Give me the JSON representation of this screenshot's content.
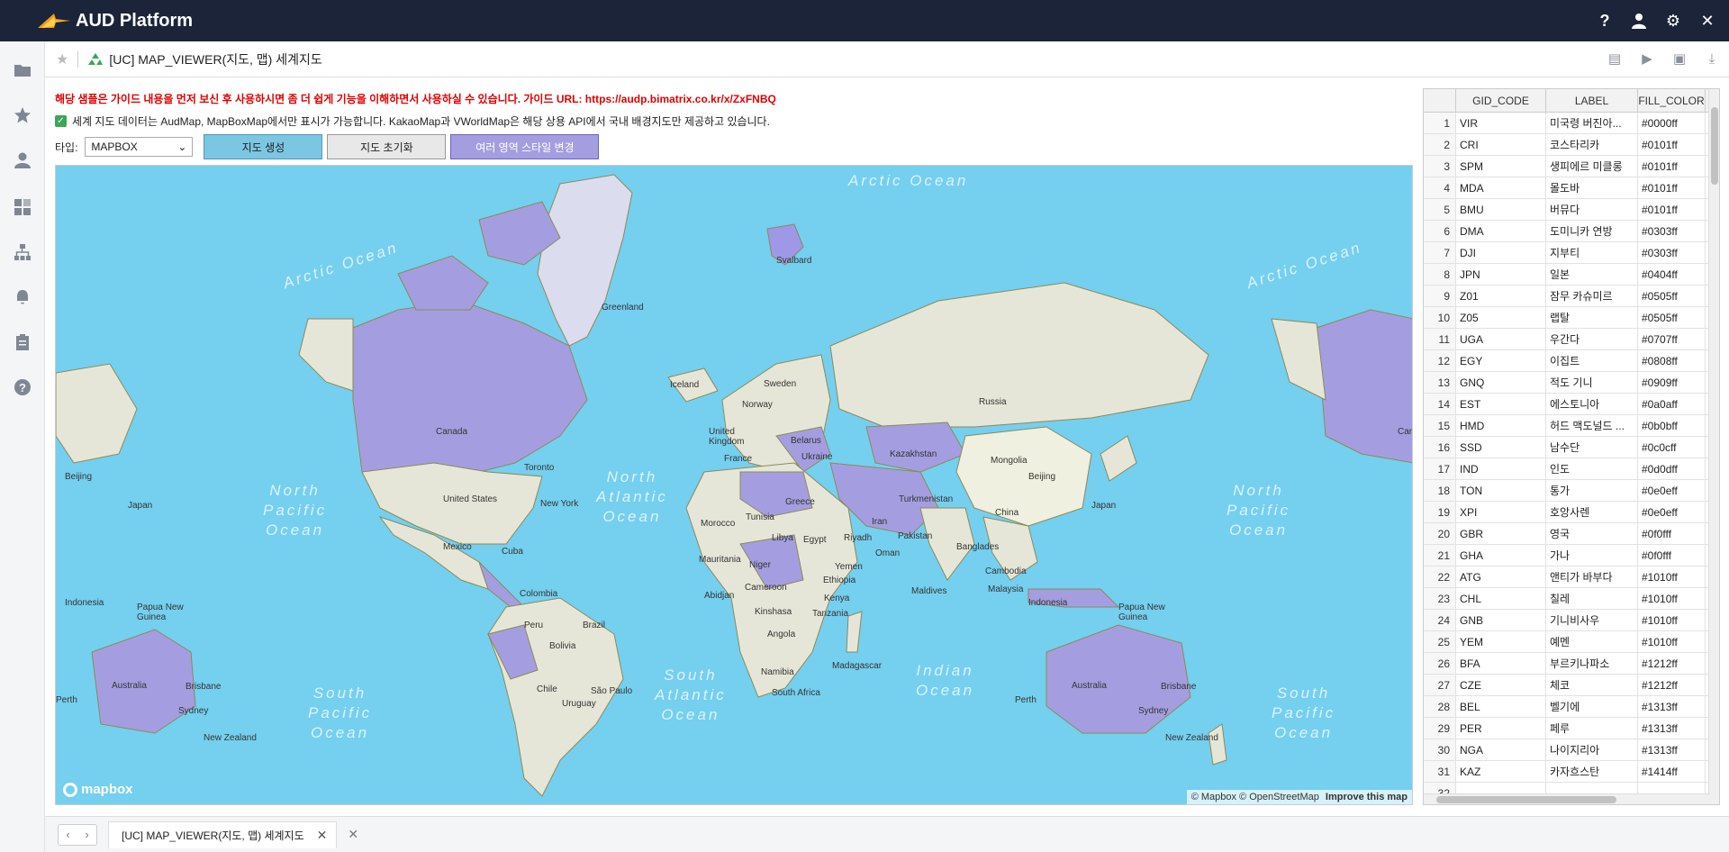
{
  "app": {
    "title": "AUD Platform"
  },
  "topbar": {
    "icons": [
      "help-icon",
      "user-icon",
      "gear-icon",
      "close-icon"
    ]
  },
  "leftnav": {
    "items": [
      "folder-icon",
      "star-icon",
      "person-icon",
      "dashboard-icon",
      "sitemap-icon",
      "alarm-icon",
      "clipboard-icon",
      "question-icon"
    ]
  },
  "page": {
    "title": "[UC] MAP_VIEWER(지도, 맵) 세계지도",
    "notice": "해당 샘플은 가이드 내용을 먼저 보신 후 사용하시면 좀 더 쉽게 기능을 이해하면서 사용하실 수 있습니다. 가이드 URL: https://audp.bimatrix.co.kr/x/ZxFNBQ",
    "check_text": "세계 지도 데이터는 AudMap, MapBoxMap에서만 표시가 가능합니다. KakaoMap과 VWorldMap은 해당 상용 API에서 국내 배경지도만 제공하고 있습니다.",
    "type_label": "타입:",
    "type_value": "MAPBOX",
    "btn_create": "지도 생성",
    "btn_reset": "지도 초기화",
    "btn_style": "여러 영역 스타일 변경"
  },
  "map": {
    "ocean_labels": {
      "arctic_top": "Arctic Ocean",
      "arctic_left": "Arctic Ocean",
      "arctic_right": "Arctic Ocean",
      "npac_left": "North\nPacific\nOcean",
      "natl": "North\nAtlantic\nOcean",
      "npac_right": "North\nPacific\nOcean",
      "spac_left": "South\nPacific\nOcean",
      "satl": "South\nAtlantic\nOcean",
      "indian": "Indian\nOcean",
      "spac_right": "South\nPacific\nOcean"
    },
    "land_labels": {
      "greenland": "Greenland",
      "svalbard": "Svalbard",
      "iceland": "Iceland",
      "sweden": "Sweden",
      "norway": "Norway",
      "russia": "Russia",
      "canada": "Canada",
      "canada2": "Can",
      "united_kingdom": "United\nKingdom",
      "belarus": "Belarus",
      "ukraine": "Ukraine",
      "france": "France",
      "kazakhstan": "Kazakhstan",
      "mongolia": "Mongolia",
      "beijing": "Beijing",
      "beijing_left": "Beijing",
      "toronto": "Toronto",
      "united_states": "United States",
      "new_york": "New York",
      "japan": "Japan",
      "japan_left": "Japan",
      "turkmenistan": "Turkmenistan",
      "greece": "Greece",
      "tunisia": "Tunisia",
      "iran": "Iran",
      "china": "China",
      "morocco": "Morocco",
      "pakistan": "Pakistan",
      "libya": "Libya",
      "egypt": "Egypt",
      "riyadh": "Riyadh",
      "mexico": "Mexico",
      "cuba": "Cuba",
      "bangladesh": "Banglades",
      "oman": "Oman",
      "mauritania": "Mauritania",
      "niger": "Niger",
      "yemen": "Yemen",
      "cambodia": "Cambodia",
      "ethiopia": "Ethiopia",
      "cameroon": "Cameroon",
      "abidjan": "Abidjan",
      "colombia": "Colombia",
      "maldives": "Maldives",
      "malaysia": "Malaysia",
      "indonesia": "Indonesia",
      "indonesia_left": "Indonesia",
      "kenya": "Kenya",
      "tanzania": "Tanzania",
      "kinshasa": "Kinshasa",
      "papua_new_guinea": "Papua New\nGuinea",
      "papua_new_guinea_left": "Papua New\nGuinea",
      "peru": "Peru",
      "brazil": "Brazil",
      "angola": "Angola",
      "bolivia": "Bolivia",
      "namibia": "Namibia",
      "madagascar": "Madagascar",
      "australia": "Australia",
      "australia_left": "Australia",
      "brisbane": "Brisbane",
      "brisbane_left": "Brisbane",
      "sao_paulo": "São Paulo",
      "chile": "Chile",
      "south_africa": "South Africa",
      "uruguay": "Uruguay",
      "perth": "Perth",
      "perth_left": "Perth",
      "sydney": "Sydney",
      "sydney_left": "Sydney",
      "new_zealand": "New Zealand",
      "new_zealand_left": "New Zealand"
    },
    "logo_text": "mapbox",
    "attribution": "© Mapbox © OpenStreetMap",
    "improve": "Improve this map"
  },
  "grid": {
    "headers": [
      "",
      "GID_CODE",
      "LABEL",
      "FILL_COLOR"
    ],
    "rows": [
      [
        "1",
        "VIR",
        "미국령 버진아...",
        "#0000ff"
      ],
      [
        "2",
        "CRI",
        "코스타리카",
        "#0101ff"
      ],
      [
        "3",
        "SPM",
        "생피에르 미클롱",
        "#0101ff"
      ],
      [
        "4",
        "MDA",
        "몰도바",
        "#0101ff"
      ],
      [
        "5",
        "BMU",
        "버뮤다",
        "#0101ff"
      ],
      [
        "6",
        "DMA",
        "도미니카 연방",
        "#0303ff"
      ],
      [
        "7",
        "DJI",
        "지부티",
        "#0303ff"
      ],
      [
        "8",
        "JPN",
        "일본",
        "#0404ff"
      ],
      [
        "9",
        "Z01",
        "잠무 카슈미르",
        "#0505ff"
      ],
      [
        "10",
        "Z05",
        "랩탈",
        "#0505ff"
      ],
      [
        "11",
        "UGA",
        "우간다",
        "#0707ff"
      ],
      [
        "12",
        "EGY",
        "이집트",
        "#0808ff"
      ],
      [
        "13",
        "GNQ",
        "적도 기니",
        "#0909ff"
      ],
      [
        "14",
        "EST",
        "에스토니아",
        "#0a0aff"
      ],
      [
        "15",
        "HMD",
        "허드 맥도널드 ...",
        "#0b0bff"
      ],
      [
        "16",
        "SSD",
        "남수단",
        "#0c0cff"
      ],
      [
        "17",
        "IND",
        "인도",
        "#0d0dff"
      ],
      [
        "18",
        "TON",
        "통가",
        "#0e0eff"
      ],
      [
        "19",
        "XPI",
        "호앙사렌",
        "#0e0eff"
      ],
      [
        "20",
        "GBR",
        "영국",
        "#0f0fff"
      ],
      [
        "21",
        "GHA",
        "가나",
        "#0f0fff"
      ],
      [
        "22",
        "ATG",
        "앤티가 바부다",
        "#1010ff"
      ],
      [
        "23",
        "CHL",
        "칠레",
        "#1010ff"
      ],
      [
        "24",
        "GNB",
        "기니비사우",
        "#1010ff"
      ],
      [
        "25",
        "YEM",
        "예멘",
        "#1010ff"
      ],
      [
        "26",
        "BFA",
        "부르키나파소",
        "#1212ff"
      ],
      [
        "27",
        "CZE",
        "체코",
        "#1212ff"
      ],
      [
        "28",
        "BEL",
        "벨기에",
        "#1313ff"
      ],
      [
        "29",
        "PER",
        "페루",
        "#1313ff"
      ],
      [
        "30",
        "NGA",
        "나이지리아",
        "#1313ff"
      ],
      [
        "31",
        "KAZ",
        "카자흐스탄",
        "#1414ff"
      ],
      [
        "32",
        "",
        "",
        ""
      ]
    ]
  },
  "bottom": {
    "tab_label": "[UC] MAP_VIEWER(지도, 맵) 세계지도",
    "tab_close": "✕",
    "close_all": "✕"
  },
  "colors": {
    "topbar": "#1b2438",
    "ocean": "#75cfef",
    "land": "#e6e6d8",
    "highlight": "#a49ee0",
    "notice": "#e00000"
  }
}
